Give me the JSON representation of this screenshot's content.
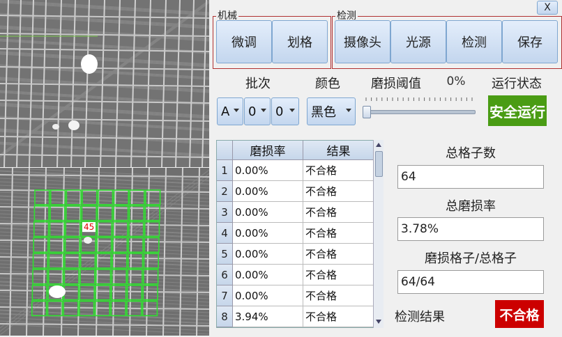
{
  "mechanics": {
    "title": "机械",
    "buttons": [
      "微调",
      "划格"
    ]
  },
  "detection": {
    "title": "检测",
    "buttons": [
      "摄像头",
      "光源",
      "检测",
      "保存"
    ]
  },
  "close_label": "X",
  "batch": {
    "label": "批次",
    "values": [
      "A",
      "0",
      "0"
    ]
  },
  "color": {
    "label": "颜色",
    "value": "黑色"
  },
  "threshold": {
    "label": "磨损阈值",
    "value_text": "0%",
    "slider_value": 0
  },
  "run_status": {
    "label": "运行状态",
    "value": "安全运行",
    "color": "#4a9c14"
  },
  "table": {
    "columns": [
      "磨损率",
      "结果"
    ],
    "rows": [
      {
        "index": "1",
        "rate": "0.00%",
        "result": "不合格"
      },
      {
        "index": "2",
        "rate": "0.00%",
        "result": "不合格"
      },
      {
        "index": "3",
        "rate": "0.00%",
        "result": "不合格"
      },
      {
        "index": "4",
        "rate": "0.00%",
        "result": "不合格"
      },
      {
        "index": "5",
        "rate": "0.00%",
        "result": "不合格"
      },
      {
        "index": "6",
        "rate": "0.00%",
        "result": "不合格"
      },
      {
        "index": "7",
        "rate": "0.00%",
        "result": "不合格"
      },
      {
        "index": "8",
        "rate": "3.94%",
        "result": "不合格"
      }
    ]
  },
  "stats": {
    "total_cells_label": "总格子数",
    "total_cells_value": "64",
    "total_wear_label": "总磨损率",
    "total_wear_value": "3.78%",
    "wear_ratio_label": "磨损格子/总格子",
    "wear_ratio_value": "64/64",
    "result_label": "检测结果",
    "result_value": "不合格",
    "result_color": "#cc0000"
  },
  "image_annotation": "45"
}
